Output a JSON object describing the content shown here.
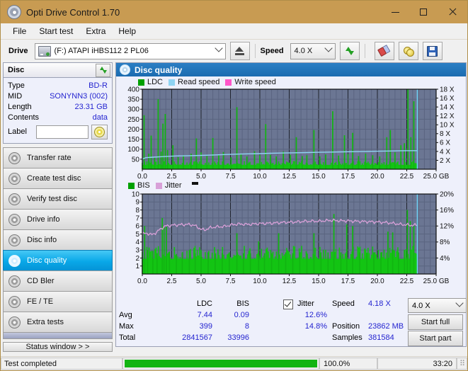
{
  "window": {
    "title": "Opti Drive Control 1.70",
    "icon": "disc-icon",
    "minimize": "minimize-icon",
    "maximize": "maximize-icon",
    "close": "close-icon"
  },
  "menu": [
    "File",
    "Start test",
    "Extra",
    "Help"
  ],
  "toolbar": {
    "drive_label": "Drive",
    "drive_value": "(F:)  ATAPI iHBS112  2 PL06",
    "eject": "eject-icon",
    "speed_label": "Speed",
    "speed_value": "4.0 X",
    "refresh": "refresh-icon",
    "erase": "erase-icon",
    "coins": "coins-icon",
    "save": "save-icon"
  },
  "disc": {
    "header": "Disc",
    "rows": [
      {
        "key": "Type",
        "value": "BD-R"
      },
      {
        "key": "MID",
        "value": "SONYNN3 (002)"
      },
      {
        "key": "Length",
        "value": "23.31 GB"
      },
      {
        "key": "Contents",
        "value": "data"
      }
    ],
    "label_key": "Label",
    "label_value": ""
  },
  "tests": [
    {
      "label": "Transfer rate",
      "selected": false
    },
    {
      "label": "Create test disc",
      "selected": false
    },
    {
      "label": "Verify test disc",
      "selected": false
    },
    {
      "label": "Drive info",
      "selected": false
    },
    {
      "label": "Disc info",
      "selected": false
    },
    {
      "label": "Disc quality",
      "selected": true
    },
    {
      "label": "CD Bler",
      "selected": false
    },
    {
      "label": "FE / TE",
      "selected": false
    },
    {
      "label": "Extra tests",
      "selected": false
    }
  ],
  "status_window_button": "Status window > >",
  "panel": {
    "title": "Disc quality"
  },
  "stats": {
    "col_ldc": "LDC",
    "col_bis": "BIS",
    "row_avg": "Avg",
    "row_max": "Max",
    "row_total": "Total",
    "ldc_avg": "7.44",
    "ldc_max": "399",
    "ldc_total": "2841567",
    "bis_avg": "0.09",
    "bis_max": "8",
    "bis_total": "33996",
    "jitter_label": "Jitter",
    "jitter_checked": true,
    "jitter_avg": "12.6%",
    "jitter_max": "14.8%",
    "speed_label": "Speed",
    "speed_value": "4.18 X",
    "position_label": "Position",
    "position_value": "23862 MB",
    "samples_label": "Samples",
    "samples_value": "381584",
    "speed_select": "4.0 X",
    "start_full": "Start full",
    "start_part": "Start part"
  },
  "statusbar": {
    "message": "Test completed",
    "percent": "100.0%",
    "time": "33:20",
    "progress": 100
  },
  "chart_data": [
    {
      "type": "line",
      "id": "ldc-chart",
      "title": "LDC / Read speed",
      "legend": [
        {
          "name": "LDC",
          "color": "#00a000"
        },
        {
          "name": "Read speed",
          "color": "#8fd4f2"
        },
        {
          "name": "Write speed",
          "color": "#ff56c8"
        }
      ],
      "legend_position": "top-left",
      "grid": true,
      "xlabel": "GB",
      "ylabel": "LDC",
      "y2label": "X",
      "xlim": [
        0,
        25
      ],
      "ylim": [
        0,
        400
      ],
      "y2lim": [
        0,
        18
      ],
      "xticks": [
        "0.0",
        "2.5",
        "5.0",
        "7.5",
        "10.0",
        "12.5",
        "15.0",
        "17.5",
        "20.0",
        "22.5",
        "25.0 GB"
      ],
      "yticks": [
        400,
        350,
        300,
        250,
        200,
        150,
        100,
        50
      ],
      "y2ticks": [
        "18 X",
        "16 X",
        "14 X",
        "12 X",
        "10 X",
        "8 X",
        "6 X",
        "4 X",
        "2 X"
      ],
      "data_end_x": 23.4,
      "series": [
        {
          "name": "Read speed",
          "color": "#8fd4f2",
          "x": [
            0.0,
            0.3,
            0.9,
            1.5,
            2.2,
            3.0,
            4.0,
            5.0,
            6.0,
            7.0,
            8.0,
            9.0,
            10.0,
            11.0,
            12.0,
            13.0,
            14.0,
            15.0,
            16.0,
            17.0,
            18.0,
            19.0,
            20.0,
            21.0,
            22.0,
            23.0,
            23.4
          ],
          "y": [
            2.3,
            2.6,
            2.7,
            2.8,
            2.9,
            3.0,
            3.05,
            3.1,
            3.2,
            3.3,
            3.4,
            3.45,
            3.5,
            3.6,
            3.65,
            3.7,
            3.75,
            3.8,
            3.85,
            3.9,
            3.95,
            4.0,
            4.05,
            4.1,
            4.15,
            4.18,
            4.18
          ]
        },
        {
          "name": "LDC spikes",
          "color": "#00a000",
          "baseline": 22,
          "spikes": [
            [
              0.15,
              270
            ],
            [
              0.55,
              78
            ],
            [
              0.75,
              168
            ],
            [
              1.05,
              62
            ],
            [
              1.35,
              350
            ],
            [
              1.6,
              88
            ],
            [
              1.75,
              228
            ],
            [
              1.95,
              276
            ],
            [
              2.15,
              96
            ],
            [
              2.6,
              120
            ],
            [
              3.05,
              60
            ],
            [
              3.5,
              70
            ],
            [
              4.15,
              78
            ],
            [
              4.6,
              154
            ],
            [
              5.0,
              84
            ],
            [
              5.5,
              66
            ],
            [
              6.0,
              156
            ],
            [
              6.5,
              72
            ],
            [
              6.9,
              86
            ],
            [
              7.55,
              60
            ],
            [
              8.05,
              310
            ],
            [
              8.4,
              74
            ],
            [
              8.9,
              64
            ],
            [
              9.55,
              90
            ],
            [
              10.0,
              70
            ],
            [
              10.5,
              226
            ],
            [
              10.9,
              72
            ],
            [
              11.4,
              64
            ],
            [
              12.0,
              88
            ],
            [
              12.6,
              72
            ],
            [
              13.1,
              160
            ],
            [
              13.6,
              66
            ],
            [
              14.0,
              70
            ],
            [
              14.6,
              196
            ],
            [
              15.1,
              64
            ],
            [
              15.6,
              74
            ],
            [
              16.2,
              290
            ],
            [
              16.7,
              68
            ],
            [
              17.2,
              170
            ],
            [
              17.5,
              76
            ],
            [
              17.9,
              182
            ],
            [
              18.4,
              66
            ],
            [
              19.0,
              78
            ],
            [
              19.6,
              70
            ],
            [
              20.2,
              64
            ],
            [
              20.8,
              160
            ],
            [
              21.1,
              196
            ],
            [
              21.5,
              84
            ],
            [
              22.0,
              120
            ],
            [
              22.3,
              130
            ],
            [
              22.6,
              399
            ],
            [
              22.85,
              160
            ],
            [
              23.1,
              340
            ]
          ]
        }
      ]
    },
    {
      "type": "line",
      "id": "bis-chart",
      "title": "BIS / Jitter",
      "legend": [
        {
          "name": "BIS",
          "color": "#00a000"
        },
        {
          "name": "Jitter",
          "color": "#d8a0d8"
        }
      ],
      "legend_position": "top-left",
      "grid": true,
      "xlabel": "GB",
      "ylabel": "BIS",
      "y2label": "%",
      "xlim": [
        0,
        25
      ],
      "ylim": [
        0,
        10
      ],
      "y2lim": [
        0,
        20
      ],
      "xticks": [
        "0.0",
        "2.5",
        "5.0",
        "7.5",
        "10.0",
        "12.5",
        "15.0",
        "17.5",
        "20.0",
        "22.5",
        "25.0 GB"
      ],
      "yticks": [
        10,
        9,
        8,
        7,
        6,
        5,
        4,
        3,
        2,
        1
      ],
      "y2ticks": [
        "20%",
        "16%",
        "12%",
        "8%",
        "4%"
      ],
      "data_end_x": 23.4,
      "series": [
        {
          "name": "Jitter",
          "color": "#d8a0d8",
          "x": [
            0.0,
            0.4,
            0.8,
            1.2,
            1.6,
            2.0,
            2.6,
            3.2,
            3.8,
            4.4,
            5.0,
            5.3,
            5.8,
            6.4,
            7.0,
            7.6,
            8.2,
            9.0,
            10.0,
            11.0,
            12.0,
            13.0,
            14.0,
            15.0,
            16.0,
            17.0,
            18.0,
            19.0,
            20.0,
            21.0,
            22.0,
            22.8,
            23.4
          ],
          "y": [
            10.0,
            10.2,
            9.8,
            10.4,
            11.4,
            12.0,
            12.2,
            12.3,
            12.4,
            12.2,
            11.2,
            11.0,
            11.6,
            11.8,
            11.9,
            12.3,
            12.5,
            12.4,
            12.6,
            12.7,
            12.9,
            13.0,
            13.2,
            13.2,
            13.4,
            13.3,
            13.2,
            13.1,
            13.0,
            12.8,
            12.4,
            12.2,
            12.2
          ]
        },
        {
          "name": "BIS spikes",
          "color": "#00a000",
          "baseline": 1.9,
          "spikes": [
            [
              0.2,
              6.0
            ],
            [
              0.45,
              3.0
            ],
            [
              0.9,
              2.9
            ],
            [
              1.25,
              2.6
            ],
            [
              1.7,
              7.0
            ],
            [
              1.85,
              5.8
            ],
            [
              2.05,
              5.9
            ],
            [
              2.3,
              2.8
            ],
            [
              2.9,
              2.5
            ],
            [
              3.4,
              2.6
            ],
            [
              4.0,
              3.0
            ],
            [
              4.5,
              2.6
            ],
            [
              5.0,
              3.0
            ],
            [
              5.6,
              2.7
            ],
            [
              6.2,
              2.5
            ],
            [
              6.8,
              2.6
            ],
            [
              7.4,
              2.7
            ],
            [
              8.05,
              5.1
            ],
            [
              8.6,
              2.6
            ],
            [
              9.2,
              2.6
            ],
            [
              9.9,
              4.1
            ],
            [
              10.4,
              2.6
            ],
            [
              11.0,
              2.6
            ],
            [
              11.6,
              5.1
            ],
            [
              12.2,
              2.7
            ],
            [
              12.8,
              2.6
            ],
            [
              13.4,
              2.7
            ],
            [
              14.0,
              2.6
            ],
            [
              14.6,
              5.1
            ],
            [
              15.2,
              2.7
            ],
            [
              15.8,
              2.7
            ],
            [
              16.3,
              7.5
            ],
            [
              16.9,
              2.7
            ],
            [
              17.4,
              6.2
            ],
            [
              17.9,
              6.0
            ],
            [
              18.5,
              2.7
            ],
            [
              19.1,
              2.6
            ],
            [
              19.7,
              2.7
            ],
            [
              20.3,
              2.7
            ],
            [
              20.9,
              5.3
            ],
            [
              21.3,
              5.2
            ],
            [
              21.8,
              2.7
            ],
            [
              22.3,
              3.0
            ],
            [
              22.55,
              8.0
            ],
            [
              22.8,
              6.6
            ],
            [
              23.1,
              6.0
            ]
          ]
        }
      ]
    }
  ]
}
